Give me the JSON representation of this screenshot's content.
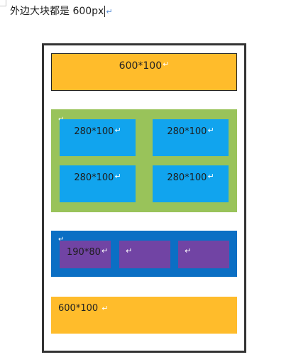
{
  "heading": {
    "text": "外边大块都是 600px"
  },
  "paragraph_mark_glyph": "↵",
  "header_block": {
    "label": "600*100",
    "color": "#FFBC2B"
  },
  "green_section": {
    "color": "#99C35A",
    "tiles": [
      {
        "label": "280*100",
        "color": "#11A4EE"
      },
      {
        "label": "280*100",
        "color": "#11A4EE"
      },
      {
        "label": "280*100",
        "color": "#11A4EE"
      },
      {
        "label": "280*100",
        "color": "#11A4EE"
      }
    ]
  },
  "blue_section": {
    "color": "#0B6FC4",
    "tiles": [
      {
        "label": "190*80",
        "color": "#7144A4"
      },
      {
        "label": "",
        "color": "#7144A4"
      },
      {
        "label": "",
        "color": "#7144A4"
      }
    ]
  },
  "footer_block": {
    "label": "600*100",
    "color": "#FFBC2B"
  }
}
